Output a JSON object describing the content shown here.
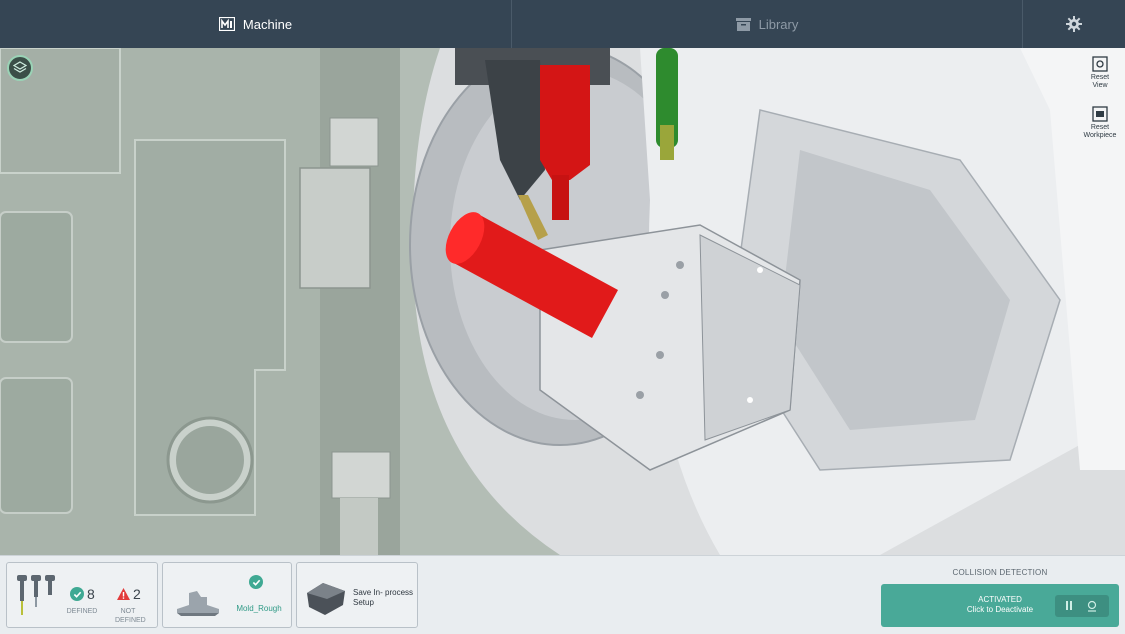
{
  "nav": {
    "machine_label": "Machine",
    "library_label": "Library",
    "machine_icon": "machine-icon",
    "library_icon": "library-icon",
    "settings_icon": "gear-icon"
  },
  "viewport": {
    "layers_icon": "layers-icon",
    "reset_view": "Reset View",
    "reset_workpiece": "Reset Workpiece"
  },
  "bottom": {
    "tools": {
      "defined_count": "8",
      "defined_label": "DEFINED",
      "not_defined_count": "2",
      "not_defined_label": "NOT DEFINED"
    },
    "part": {
      "name": "Mold_Rough"
    },
    "save": {
      "label": "Save In- process Setup"
    },
    "collision": {
      "title": "COLLISION DETECTION",
      "status": "ACTIVATED",
      "action": "Click to Deactivate",
      "pause_icon": "pause-icon",
      "settings_icon": "collision-settings-icon"
    }
  },
  "colors": {
    "nav_bg": "#354554",
    "accent": "#49a998",
    "collision_red": "#e11a1a",
    "tool_green": "#2e8b2e"
  }
}
